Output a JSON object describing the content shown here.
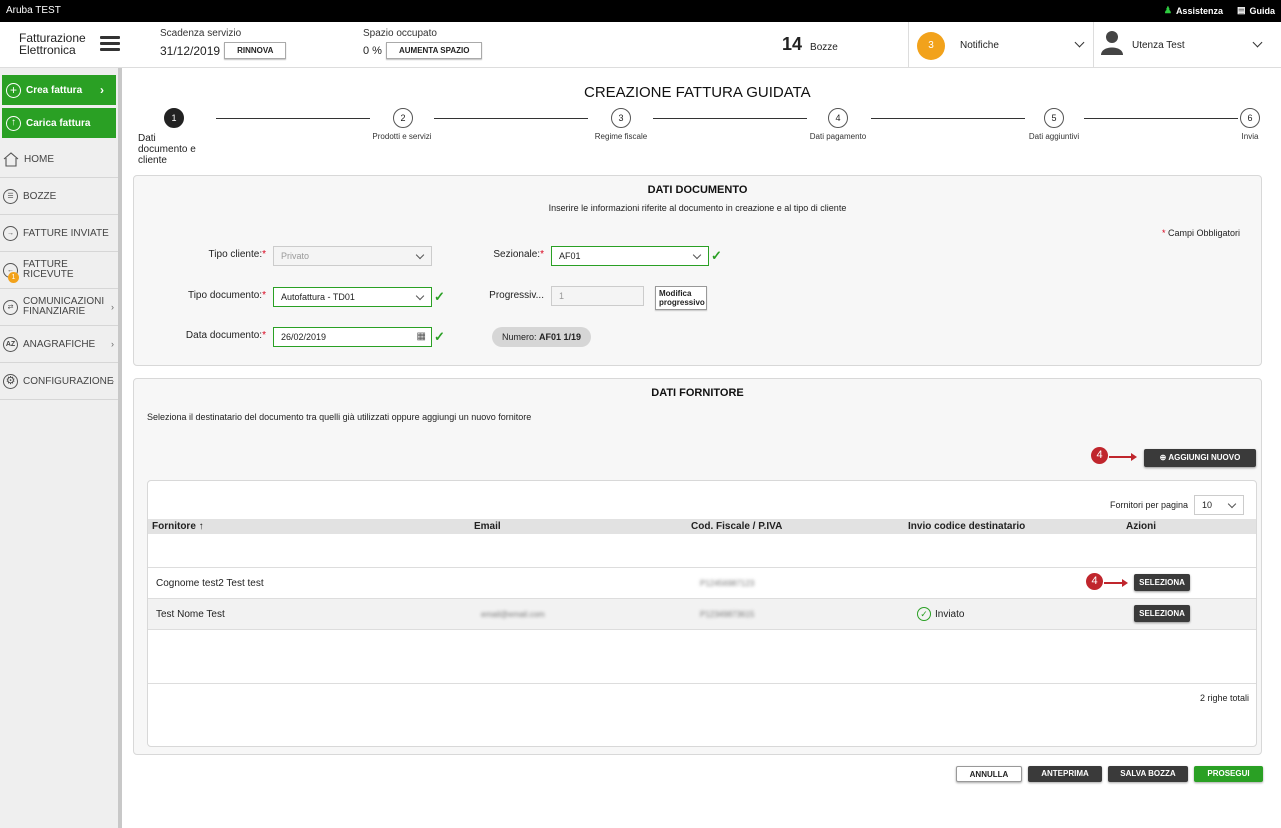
{
  "topbar": {
    "title": "Aruba TEST",
    "assistenza": "Assistenza",
    "guida": "Guida"
  },
  "header": {
    "logo_line1": "Fatturazione",
    "logo_line2": "Elettronica",
    "scadenza_label": "Scadenza servizio",
    "scadenza_value": "31/12/2019",
    "rinnova": "RINNOVA",
    "spazio_label": "Spazio occupato",
    "spazio_value": "0 %",
    "aumenta": "AUMENTA SPAZIO",
    "bozze_count": "14",
    "bozze_label": "Bozze",
    "notifiche_count": "3",
    "notifiche_label": "Notifiche",
    "user_label": "Utenza Test"
  },
  "sidebar": {
    "crea": "Crea fattura",
    "carica": "Carica fattura",
    "items": [
      {
        "label": "HOME",
        "icon": "home-icon"
      },
      {
        "label": "BOZZE",
        "icon": "drafts-icon"
      },
      {
        "label": "FATTURE INVIATE",
        "icon": "arrow-right-icon"
      },
      {
        "label1": "FATTURE",
        "label2": "RICEVUTE",
        "icon": "arrow-left-icon",
        "badge": "1"
      },
      {
        "label1": "COMUNICAZIONI",
        "label2": "FINANZIARIE",
        "icon": "communications-icon"
      },
      {
        "label": "ANAGRAFICHE",
        "icon": "az-icon"
      },
      {
        "label": "CONFIGURAZIONE",
        "icon": "gear-icon"
      }
    ]
  },
  "main": {
    "title": "CREAZIONE FATTURA GUIDATA",
    "steps": [
      {
        "n": "1",
        "l1": "Dati",
        "l2": "documento e",
        "l3": "cliente"
      },
      {
        "n": "2",
        "label": "Prodotti e servizi"
      },
      {
        "n": "3",
        "label": "Regime fiscale"
      },
      {
        "n": "4",
        "label": "Dati pagamento"
      },
      {
        "n": "5",
        "label": "Dati aggiuntivi"
      },
      {
        "n": "6",
        "label": "Invia"
      }
    ]
  },
  "documento": {
    "title": "DATI DOCUMENTO",
    "subtitle": "Inserire le informazioni riferite al documento in creazione e al tipo di cliente",
    "required_note": "Campi Obbligatori",
    "tipo_cliente_label": "Tipo cliente:",
    "tipo_cliente_value": "Privato",
    "sezionale_label": "Sezionale:",
    "sezionale_value": "AF01",
    "tipo_documento_label": "Tipo documento:",
    "tipo_documento_value": "Autofattura - TD01",
    "progressivo_label": "Progressiv...",
    "progressivo_value": "1",
    "modifica_line1": "Modifica",
    "modifica_line2": "progressivo",
    "data_label": "Data documento:",
    "data_value": "26/02/2019",
    "numero_label": "Numero:",
    "numero_value": "AF01 1/19"
  },
  "fornitore": {
    "title": "DATI FORNITORE",
    "subtitle": "Seleziona il destinatario del documento tra quelli già utilizzati oppure aggiungi un nuovo fornitore",
    "aggiungi": "AGGIUNGI NUOVO",
    "callout": "4",
    "per_pagina_label": "Fornitori per pagina",
    "per_pagina_value": "10",
    "columns": [
      "Fornitore ↑",
      "Email",
      "Cod. Fiscale / P.IVA",
      "Invio codice destinatario",
      "Azioni"
    ],
    "rows": [
      {
        "nome": "Cognome test2 Test test",
        "email": "",
        "cf": "P12456987123",
        "invio": "",
        "azione": "SELEZIONA"
      },
      {
        "nome": "Test Nome Test",
        "email": "email@email.com",
        "cf": "P12349873615",
        "invio": "Inviato",
        "azione": "SELEZIONA"
      }
    ],
    "totali": "2 righe totali"
  },
  "footer": {
    "annulla": "ANNULLA",
    "anteprima": "ANTEPRIMA",
    "salva": "SALVA BOZZA",
    "prosegui": "PROSEGUI"
  },
  "colors": {
    "green": "#2aa024",
    "orange": "#f2a21b",
    "dark": "#3a3a3a",
    "red": "#c0262d"
  }
}
